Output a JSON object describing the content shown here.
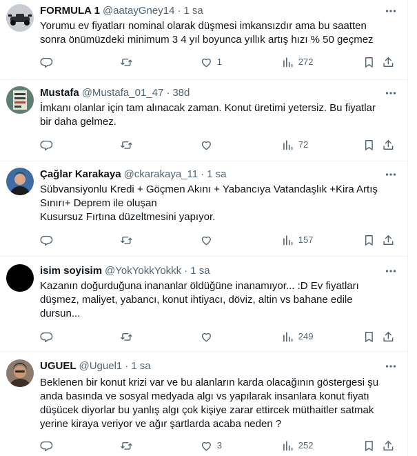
{
  "tweets": [
    {
      "name": "FORMULA 1",
      "handle": "@aatayGney14",
      "time": "1 sa",
      "lines": [
        "Yorumu ev fiyatları nominal olarak düşmesi imkansızdır ama bu saatten",
        "sonra önümüzdeki minimum 3 4 yıl boyunca yıllık artış hızı % 50 geçmez"
      ],
      "replies": "",
      "retweets": "",
      "likes": "1",
      "views": "272"
    },
    {
      "name": "Mustafa",
      "handle": "@Mustafa_01_47",
      "time": "38d",
      "lines": [
        "İmkanı olanlar için tam alınacak zaman. Konut üretimi yetersiz. Bu fiyatlar",
        "bir daha gelmez."
      ],
      "replies": "",
      "retweets": "",
      "likes": "",
      "views": "72"
    },
    {
      "name": "Çağlar Karakaya",
      "handle": "@ckarakaya_11",
      "time": "1 sa",
      "lines": [
        "Sübvansiyonlu Kredi + Göçmen Akını + Yabancıya Vatandaşlık +Kira Artış",
        "Sınırı+ Deprem ile oluşan",
        "Kusursuz Fırtına düzeltmesini yapıyor."
      ],
      "replies": "",
      "retweets": "",
      "likes": "",
      "views": "157"
    },
    {
      "name": "isim soyisim",
      "handle": "@YokYokkYokkk",
      "time": "1 sa",
      "lines": [
        "Kazanın doğurduğuna inananlar öldüğüne inanamıyor... :D Ev fiyatları",
        "düşmez, maliyet, yabancı, konut ihtiyacı, döviz, altin vs bahane edile",
        "dursun..."
      ],
      "replies": "",
      "retweets": "",
      "likes": "",
      "views": "249"
    },
    {
      "name": "UGUEL",
      "handle": "@Uguel1",
      "time": "1 sa",
      "lines": [
        "Beklenen bir konut krizi var ve bu alanların karda olacağının göstergesi şu",
        "anda basında ve sosyal medyada algı vs yapılarak insanlara konut fiyatı",
        "düşücek diyorlar bu yanlış algı çok kişiye zarar ettircek müthaitler satmak",
        "yerine kiraya veriyor ve ağır şartlarda acaba neden ?"
      ],
      "replies": "",
      "retweets": "",
      "likes": "3",
      "views": "252"
    }
  ]
}
